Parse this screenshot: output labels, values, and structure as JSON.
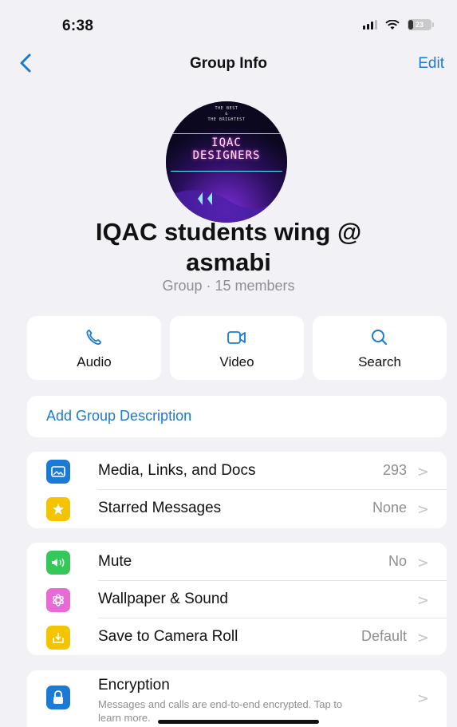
{
  "status_bar": {
    "time": "6:38",
    "battery": "23",
    "battery_level": 0.23
  },
  "nav": {
    "back_icon": "chevron-left-icon",
    "title": "Group Info",
    "edit_label": "Edit"
  },
  "avatar": {
    "line1": "THE BEST",
    "line2": "&",
    "line3": "THE BRIGHTEST",
    "title_line1": "IQAC",
    "title_line2": "DESIGNERS"
  },
  "group": {
    "name": "IQAC students wing @ asmabi",
    "subtitle": "Group · 15 members"
  },
  "actions": [
    {
      "label": "Audio",
      "icon": "phone-icon"
    },
    {
      "label": "Video",
      "icon": "video-icon"
    },
    {
      "label": "Search",
      "icon": "search-icon"
    }
  ],
  "description": {
    "label": "Add Group Description"
  },
  "media_section": [
    {
      "label": "Media, Links, and Docs",
      "value": "293",
      "icon": "photo-icon",
      "color": "#1a7ad4"
    },
    {
      "label": "Starred Messages",
      "value": "None",
      "icon": "star-icon",
      "color": "#f5c400"
    }
  ],
  "settings_section": [
    {
      "label": "Mute",
      "value": "No",
      "icon": "speaker-icon",
      "color": "#34c759"
    },
    {
      "label": "Wallpaper & Sound",
      "value": "",
      "icon": "flower-icon",
      "color": "#e86ad6"
    },
    {
      "label": "Save to Camera Roll",
      "value": "Default",
      "icon": "download-icon",
      "color": "#f5c400"
    }
  ],
  "encryption": {
    "title": "Encryption",
    "subtitle": "Messages and calls are end-to-end encrypted. Tap to learn more.",
    "icon": "lock-icon",
    "color": "#1a7ad4"
  },
  "chevron": ">"
}
